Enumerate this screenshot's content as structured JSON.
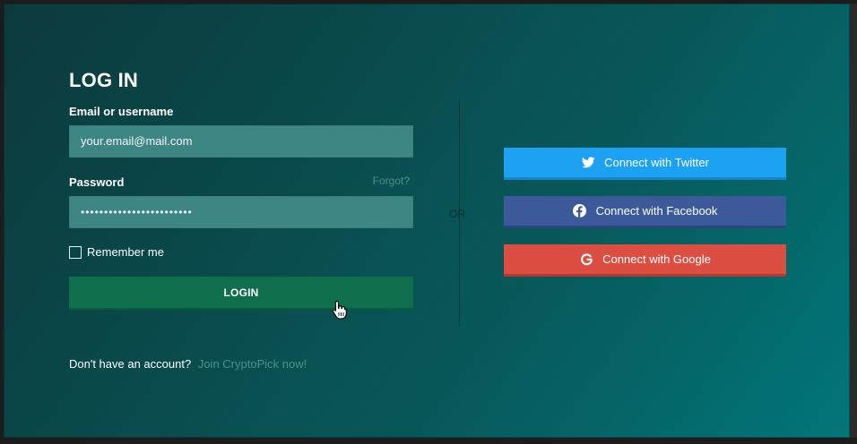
{
  "login": {
    "title": "LOG IN",
    "email_label": "Email or username",
    "email_value": "your.email@mail.com",
    "password_label": "Password",
    "forgot_label": "Forgot?",
    "password_value": "••••••••••••••••••••••••",
    "remember_label": "Remember me",
    "remember_checked": false,
    "login_button": "LOGIN"
  },
  "divider": {
    "or_label": "OR"
  },
  "social": {
    "twitter_label": "Connect with Twitter",
    "facebook_label": "Connect with Facebook",
    "google_label": "Connect with Google",
    "twitter_color": "#1da1f2",
    "facebook_color": "#3c5a99",
    "google_color": "#dc4e41"
  },
  "footer": {
    "prompt": "Don't have an account?",
    "signup_link": "Join CryptoPick now!"
  }
}
